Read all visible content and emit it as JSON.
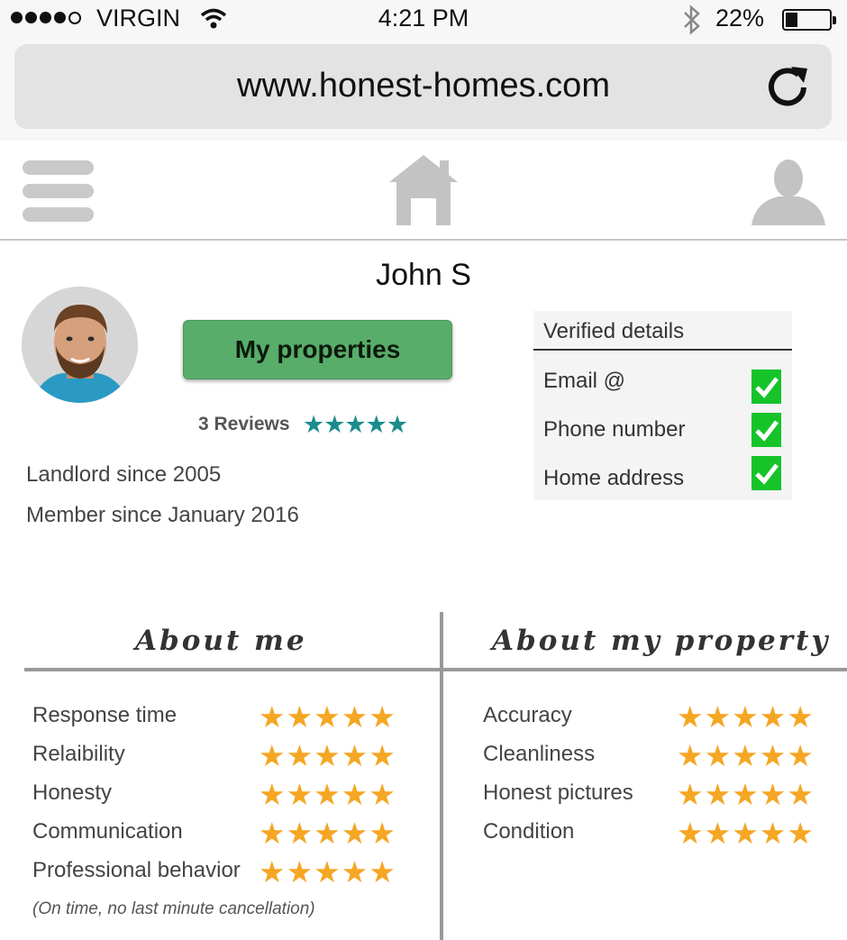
{
  "status_bar": {
    "carrier": "VIRGIN",
    "time": "4:21 PM",
    "battery": "22%",
    "battery_level": 0.22
  },
  "browser": {
    "url": "www.honest-homes.com",
    "reload_icon": "reload-icon"
  },
  "nav": {
    "menu_icon": "hamburger-icon",
    "home_icon": "home-icon",
    "profile_icon": "user-icon"
  },
  "profile": {
    "name": "John S",
    "button_label": "My properties",
    "reviews": "3 Reviews",
    "review_stars": "★★★★★",
    "landlord_since": "Landlord since 2005",
    "member_since": "Member since January 2016"
  },
  "verified": {
    "title": "Verified details",
    "items": [
      "Email @",
      "Phone number",
      "Home address"
    ]
  },
  "about_me": {
    "title": "About me",
    "ratings": [
      {
        "label": "Response time",
        "stars": "★★★★★"
      },
      {
        "label": "Relaibility",
        "stars": "★★★★★"
      },
      {
        "label": "Honesty",
        "stars": "★★★★★"
      },
      {
        "label": "Communication",
        "stars": "★★★★★"
      },
      {
        "label": "Professional behavior",
        "stars": "★★★★★"
      }
    ],
    "note": "(On time, no last minute cancellation)"
  },
  "about_property": {
    "title": "About my property",
    "ratings": [
      {
        "label": "Accuracy",
        "stars": "★★★★★"
      },
      {
        "label": "Cleanliness",
        "stars": "★★★★★"
      },
      {
        "label": "Honest pictures",
        "stars": "★★★★★"
      },
      {
        "label": "Condition",
        "stars": "★★★★★"
      }
    ]
  },
  "colors": {
    "accent_green": "#58ad6a",
    "teal": "#1b8c8c",
    "star_orange": "#f5a623",
    "check_green": "#16c42a"
  }
}
